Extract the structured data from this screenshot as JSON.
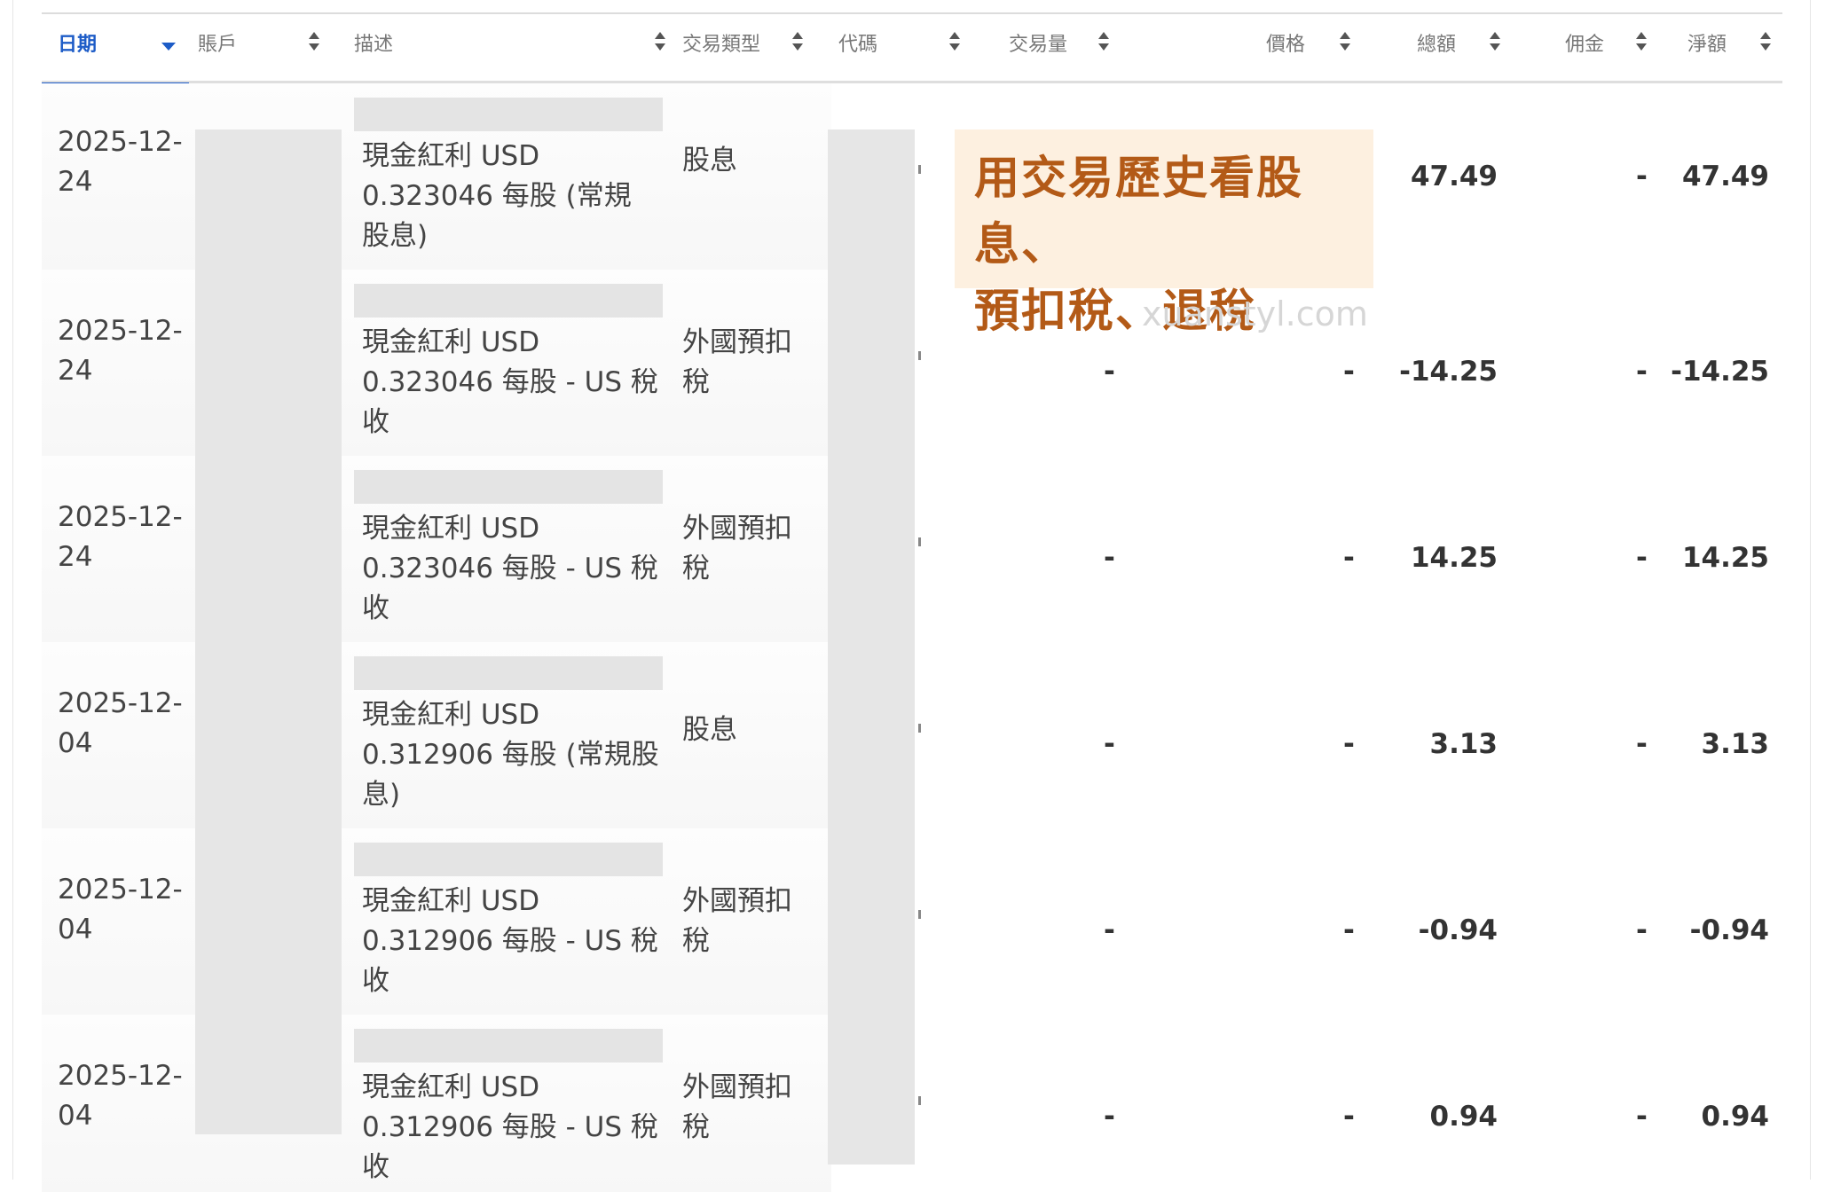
{
  "colors": {
    "accent": "#1d5cc7",
    "banner_bg": "#fdf0e0",
    "banner_text": "#b35a17",
    "redaction": "#e6e6e6"
  },
  "table": {
    "columns": [
      {
        "key": "date",
        "label": "日期",
        "sorted": true
      },
      {
        "key": "account",
        "label": "賬戶"
      },
      {
        "key": "description",
        "label": "描述"
      },
      {
        "key": "type",
        "label": "交易類型"
      },
      {
        "key": "symbol",
        "label": "代碼"
      },
      {
        "key": "quantity",
        "label": "交易量"
      },
      {
        "key": "price",
        "label": "價格"
      },
      {
        "key": "gross",
        "label": "總額"
      },
      {
        "key": "commission",
        "label": "佣金"
      },
      {
        "key": "net",
        "label": "淨額"
      }
    ],
    "rows": [
      {
        "date": "2025-12-\n24",
        "description": "現金紅利 USD\n0.323046 每股 (常規\n股息)",
        "type": "股息",
        "quantity": "",
        "price": "",
        "gross": "47.49",
        "commission": "-",
        "net": "47.49"
      },
      {
        "date": "2025-12-\n24",
        "description": "現金紅利 USD\n0.323046 每股 - US 稅\n收",
        "type": "外國預扣\n稅",
        "quantity": "-",
        "price": "-",
        "gross": "-14.25",
        "commission": "-",
        "net": "-14.25"
      },
      {
        "date": "2025-12-\n24",
        "description": "現金紅利 USD\n0.323046 每股 - US 稅\n收",
        "type": "外國預扣\n稅",
        "quantity": "-",
        "price": "-",
        "gross": "14.25",
        "commission": "-",
        "net": "14.25"
      },
      {
        "date": "2025-12-\n04",
        "description": "現金紅利 USD\n0.312906 每股 (常規股\n息)",
        "type": "股息",
        "quantity": "-",
        "price": "-",
        "gross": "3.13",
        "commission": "-",
        "net": "3.13"
      },
      {
        "date": "2025-12-\n04",
        "description": "現金紅利 USD\n0.312906 每股 - US 稅\n收",
        "type": "外國預扣\n稅",
        "quantity": "-",
        "price": "-",
        "gross": "-0.94",
        "commission": "-",
        "net": "-0.94"
      },
      {
        "date": "2025-12-\n04",
        "description": "現金紅利 USD\n0.312906 每股 - US 稅\n收",
        "type": "外國預扣\n稅",
        "quantity": "-",
        "price": "-",
        "gross": "0.94",
        "commission": "-",
        "net": "0.94"
      }
    ]
  },
  "banner": {
    "text": "用交易歷史看股息、\n預扣稅、退稅"
  },
  "watermark": "xuanstyl.com"
}
